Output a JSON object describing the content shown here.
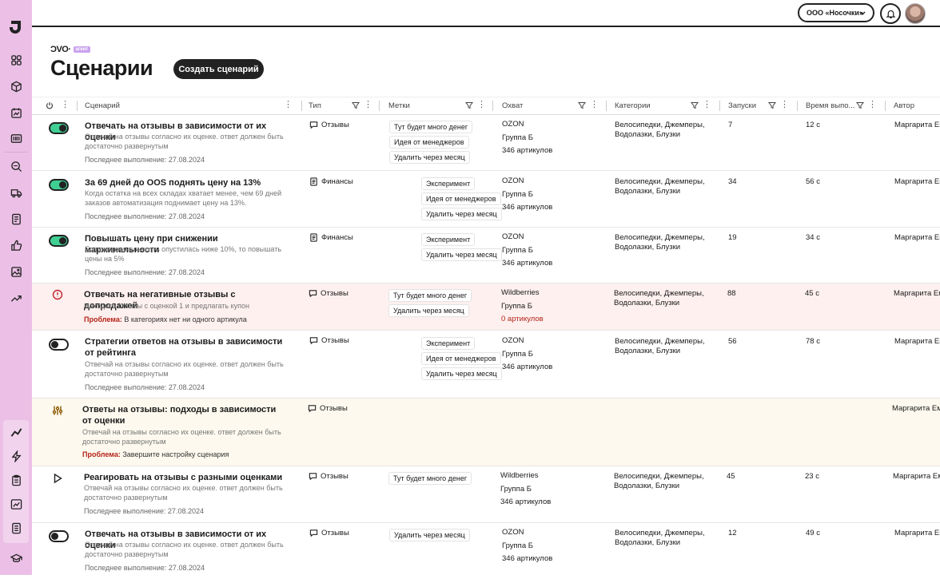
{
  "brand": {
    "wordmark": "ƆVO·",
    "tag": "агент"
  },
  "header": {
    "org_select": "ООО «Носочки»"
  },
  "page": {
    "title": "Сценарии",
    "create_button": "Создать сценарий"
  },
  "columns": {
    "scenario": "Сценарий",
    "type": "Тип",
    "tags": "Метки",
    "coverage": "Охват",
    "categories": "Категории",
    "runs": "Запуски",
    "duration": "Время выпо...",
    "author": "Автор"
  },
  "rows": [
    {
      "status": "on",
      "title": "Отвечать на отзывы в зависимости от их оценки",
      "desc": "Отвечай на отзывы согласно их оценке. ответ должен быть достаточно развернутым",
      "last": "Последнее выполнение: 27.08.2024",
      "type": "Отзывы",
      "tags": [
        "Тут будет много денег",
        "Идея от менеджеров",
        "Удалить через месяц"
      ],
      "coverage": [
        "OZON",
        "Группа Б",
        "346 артикулов"
      ],
      "categories": "Велосипедки, Джемперы, Водолазки, Блузки",
      "runs": "7",
      "time": "12 с",
      "author": "Маргарита Ем"
    },
    {
      "status": "on",
      "title": "За 69 дней до OOS поднять цену на 13%",
      "desc": "Когда остатка на всех складах хватает менее, чем 69 дней заказов автоматизация поднимает цену на 13%.",
      "last": "Последнее выполнение: 27.08.2024",
      "type": "Финансы",
      "tags": [
        "Эксперимент",
        "Идея от менеджеров",
        "Удалить через месяц"
      ],
      "coverage": [
        "OZON",
        "Группа Б",
        "346 артикулов"
      ],
      "categories": "Велосипедки, Джемперы, Водолазки, Блузки",
      "runs": "34",
      "time": "56 с",
      "author": "Маргарита Ем"
    },
    {
      "status": "on",
      "title": "Повышать цену при снижении маржинальности",
      "desc": "Если маржинальность опустилась ниже 10%, то повышать цены на 5%",
      "last": "Последнее выполнение: 27.08.2024",
      "type": "Финансы",
      "tags": [
        "Эксперимент",
        "Удалить через месяц"
      ],
      "coverage": [
        "OZON",
        "Группа Б",
        "346 артикулов"
      ],
      "categories": "Велосипедки, Джемперы, Водолазки, Блузки",
      "runs": "19",
      "time": "34 с",
      "author": "Маргарита Ем"
    },
    {
      "status": "error",
      "title": "Отвечать на негативные отзывы с допродажей",
      "desc": "Находить отзывы с оценкой 1 и предлагать купон",
      "problem_label": "Проблема:",
      "problem_text": " В категориях нет ни одного артикула",
      "type": "Отзывы",
      "tags": [
        "Тут будет много денег",
        "Удалить через месяц"
      ],
      "coverage": [
        "Wildberries",
        "Группа Б",
        "0 артикулов"
      ],
      "categories": "Велосипедки, Джемперы, Водолазки, Блузки",
      "runs": "88",
      "time": "45 с",
      "author": "Маргарита Ем"
    },
    {
      "status": "off",
      "title": "Стратегии ответов на отзывы в зависимости от рейтинга",
      "desc": "Отвечай на отзывы согласно их оценке. ответ должен быть достаточно развернутым",
      "last": "Последнее выполнение: 27.08.2024",
      "type": "Отзывы",
      "tags": [
        "Эксперимент",
        "Идея от менеджеров",
        "Удалить через месяц"
      ],
      "coverage": [
        "OZON",
        "Группа Б",
        "346 артикулов"
      ],
      "categories": "Велосипедки, Джемперы, Водолазки, Блузки",
      "runs": "56",
      "time": "78 с",
      "author": "Маргарита Ем"
    },
    {
      "status": "draft",
      "title": "Ответы на отзывы: подходы в зависимости от оценки",
      "desc": "Отвечай на отзывы согласно их оценке. ответ должен быть достаточно развернутым",
      "problem_label": "Проблема:",
      "problem_text": " Завершите настройку сценария",
      "type": "Отзывы",
      "author": "Маргарита Ем"
    },
    {
      "status": "play",
      "title": "Реагировать на отзывы с разными оценками",
      "desc": "Отвечай на отзывы согласно их оценке. ответ должен быть достаточно развернутым",
      "last": "Последнее выполнение: 27.08.2024",
      "type": "Отзывы",
      "tags": [
        "Тут будет много денег"
      ],
      "coverage": [
        "Wildberries",
        "Группа Б",
        "346 артикулов"
      ],
      "categories": "Велосипедки, Джемперы, Водолазки, Блузки",
      "runs": "45",
      "time": "23 с",
      "author": "Маргарита Ем"
    },
    {
      "status": "off",
      "title": "Отвечать на отзывы в зависимости от их оценки",
      "desc": "Отвечай на отзывы согласно их оценке. ответ должен быть достаточно развернутым",
      "last": "Последнее выполнение: 27.08.2024",
      "type": "Отзывы",
      "tags": [
        "Удалить через месяц"
      ],
      "coverage": [
        "OZON",
        "Группа Б",
        "346 артикулов"
      ],
      "categories": "Велосипедки, Джемперы, Водолазки, Блузки",
      "runs": "12",
      "time": "49 с",
      "author": "Маргарита Ем"
    }
  ]
}
